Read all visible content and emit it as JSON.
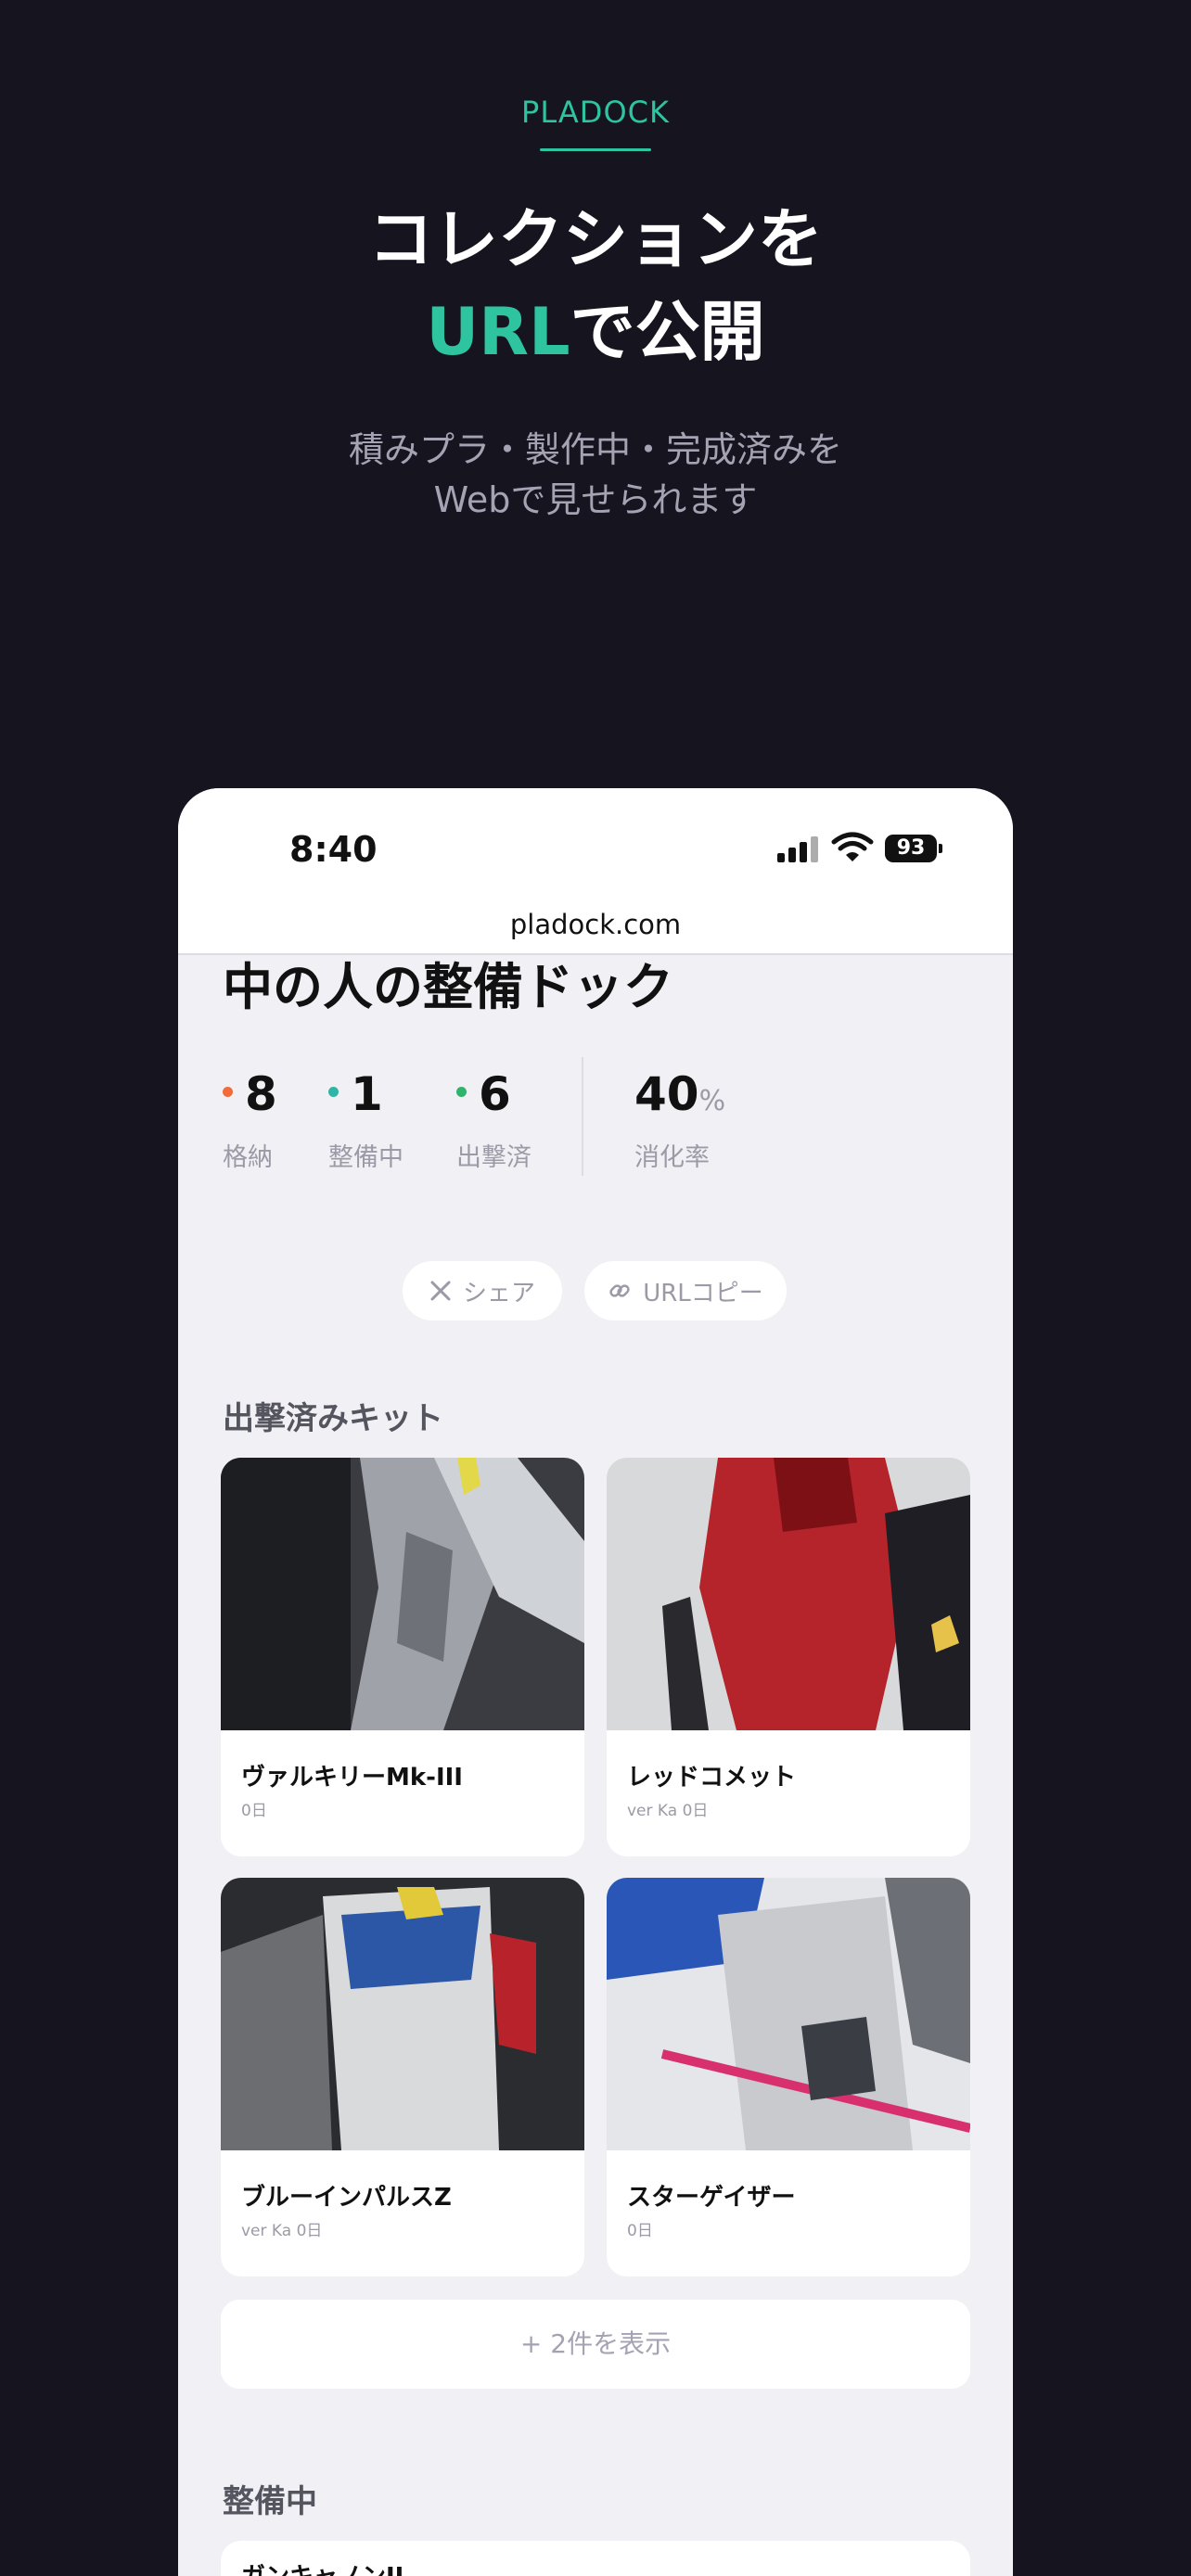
{
  "hero": {
    "brand": "PLADOCK",
    "headline_line1": "コレクションを",
    "headline_accent": "URL",
    "headline_line2_rest": "で公開",
    "subhead_line1": "積みプラ・製作中・完成済みを",
    "subhead_line2": "Webで見せられます"
  },
  "status_bar": {
    "time": "8:40",
    "battery": "93"
  },
  "browser": {
    "url": "pladock.com"
  },
  "page": {
    "title": "中の人の整備ドック"
  },
  "stats": [
    {
      "value": "8",
      "label": "格納",
      "color": "#f26b3a"
    },
    {
      "value": "1",
      "label": "整備中",
      "color": "#2eb5a6"
    },
    {
      "value": "6",
      "label": "出撃済",
      "color": "#2fb46b"
    }
  ],
  "rate": {
    "value": "40",
    "unit": "%",
    "label": "消化率"
  },
  "actions": {
    "share": "シェア",
    "copy_url": "URLコピー"
  },
  "sections": {
    "deployed": "出撃済みキット",
    "in_progress": "整備中"
  },
  "kits": [
    {
      "name": "ヴァルキリーMk-III",
      "meta": "0日"
    },
    {
      "name": "レッドコメット",
      "meta": "ver Ka  0日"
    },
    {
      "name": "ブルーインパルスZ",
      "meta": "ver Ka  0日"
    },
    {
      "name": "スターゲイザー",
      "meta": "0日"
    }
  ],
  "show_more": "+ 2件を表示",
  "in_progress_kits": [
    {
      "name": "ガンキャノンII"
    }
  ],
  "colors": {
    "accent": "#2ec4a0",
    "background": "#15141f"
  }
}
